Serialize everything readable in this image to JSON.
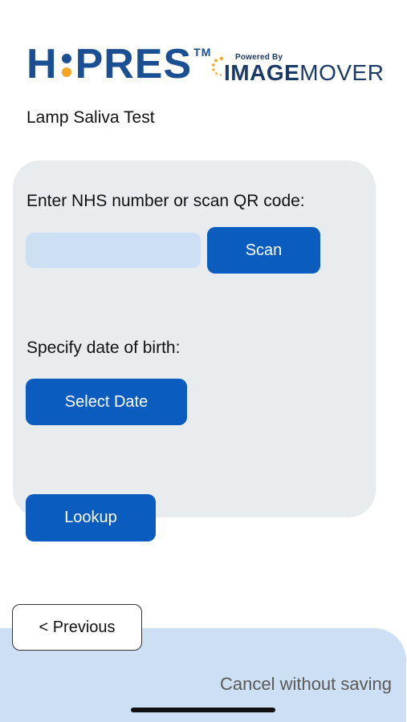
{
  "header": {
    "hipres_logo": {
      "letters_before": "H",
      "letters_after": "PRES",
      "trademark": "TM",
      "colors": {
        "primary": "#1b4f93",
        "accent": "#f5a623"
      }
    },
    "imagemover_logo": {
      "powered_by": "Powered By",
      "word_bold": "IMAGE",
      "word_light": "MOVER",
      "icon": "swirl-logo-icon"
    }
  },
  "subtitle": "Lamp Saliva Test",
  "form": {
    "nhs_label": "Enter NHS number or scan QR code:",
    "nhs_input": {
      "value": "",
      "placeholder": ""
    },
    "scan_button": "Scan",
    "dob_label": "Specify date of birth:",
    "select_date_button": "Select Date",
    "lookup_button": "Lookup"
  },
  "footer": {
    "previous_button": "< Previous",
    "cancel_link": "Cancel without saving"
  },
  "colors": {
    "button_primary": "#0a5cbf",
    "card_background": "#e9ecee",
    "input_background": "#cddff3",
    "footer_background": "#cddff3"
  }
}
